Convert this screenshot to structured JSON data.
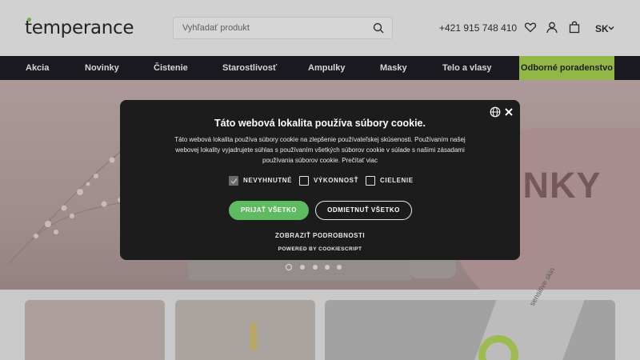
{
  "header": {
    "logo_text": "temperance",
    "search_placeholder": "Vyhľadať produkt",
    "phone": "+421 915 748 410",
    "language": "SK",
    "icons": [
      "search-icon",
      "heart-icon",
      "user-icon",
      "cart-icon",
      "chevron-down-icon"
    ]
  },
  "nav": {
    "items": [
      "Akcia",
      "Novinky",
      "Čistenie",
      "Starostlivosť",
      "Ampulky",
      "Masky",
      "Telo a vlasy"
    ],
    "highlight": "Odborné poradenstvo"
  },
  "hero": {
    "title_visible": "INKY",
    "slide_count": 5,
    "active_slide": 1
  },
  "cookie": {
    "title": "Táto webová lokalita používa súbory cookie.",
    "body": "Táto webová lokalita používa súbory cookie na zlepšenie používateľskej skúsenosti. Používaním našej webovej lokality vyjadrujete súhlas s používaním všetkých súborov cookie v súlade s našimi zásadami používania súborov cookie.",
    "read_more": "Prečítať viac",
    "options": [
      {
        "label": "NEVYHNUTNÉ",
        "checked": true,
        "disabled": true
      },
      {
        "label": "VÝKONNOSŤ",
        "checked": false,
        "disabled": false
      },
      {
        "label": "CIELENIE",
        "checked": false,
        "disabled": false
      }
    ],
    "accept_label": "PRIJAŤ VŠETKO",
    "reject_label": "ODMIETNUŤ VŠETKO",
    "details_label": "ZOBRAZIŤ PODROBNOSTI",
    "powered_by": "POWERED BY COOKIESCRIPT"
  },
  "cards": {
    "product_text": "sensitive skin"
  },
  "colors": {
    "nav_bg": "#0b0b12",
    "accent_green": "#8cb33a",
    "accept_green": "#5fbb62",
    "dialog_bg": "#1c1c1c"
  }
}
